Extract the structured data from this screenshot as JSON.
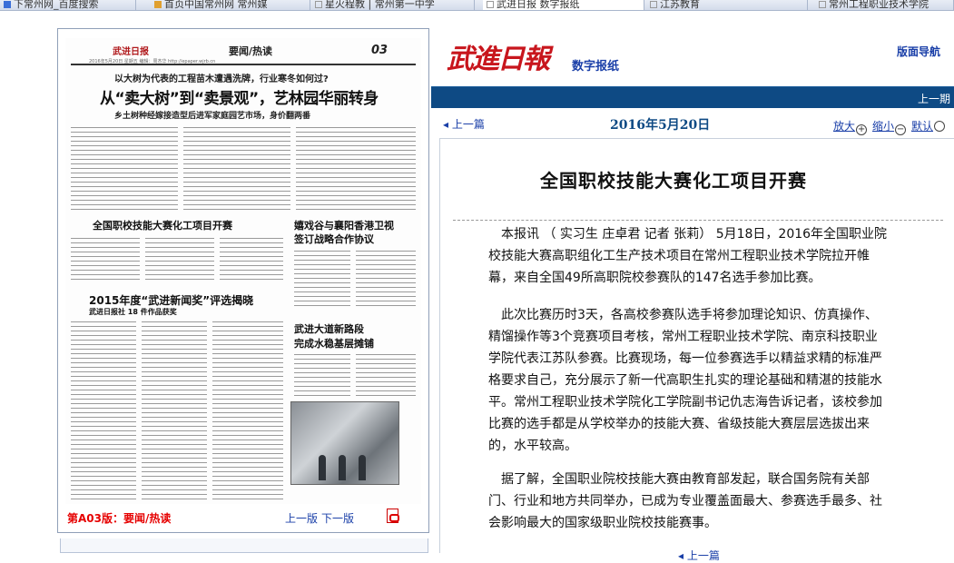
{
  "browser": {
    "tabs": [
      {
        "label": "下常州网_百度搜索",
        "active": false
      },
      {
        "label": "首页中国常州网 常州媒",
        "active": false
      },
      {
        "label": "星火程教 | 常州第一中学",
        "active": false
      },
      {
        "label": "武进日报 数字报纸",
        "active": true
      },
      {
        "label": "江苏教育",
        "active": false
      },
      {
        "label": "常州工程职业技术学院",
        "active": false
      }
    ]
  },
  "thumbnail": {
    "logo": "武进日报",
    "section": "要闻/热读",
    "page_no": "03",
    "meta": "2016年5月20日 星期五    编辑：周杰华    http://epaper.wjrb.cn",
    "kicker": "以大树为代表的工程苗木遭遇洗牌，行业寒冬如何过?",
    "headline": "从“卖大树”到“卖景观”，艺林园华丽转身",
    "subhead": "乡土树种经嫁接造型后进军家庭园艺市场，身价翻两番",
    "story2_title": "全国职校技能大赛化工项目开赛",
    "story3_title_1": "嬉戏谷与襄阳香港卫视",
    "story3_title_2": "签订战略合作协议",
    "story4_title": "2015年度“武进新闻奖”评选揭晓",
    "story4_sub": "武进日报社 18 件作品获奖",
    "story5_title_1": "武进大道新路段",
    "story5_title_2": "完成水稳基层摊铺"
  },
  "thumb_footer": {
    "section_label": "第A03版：要闻/热读",
    "prev": "上一版",
    "next": "下一版",
    "pdf_icon": "pdf-icon"
  },
  "masthead": {
    "logo": "武進日報",
    "subtitle": "数字报纸",
    "nav": "版面导航"
  },
  "bluebar": {
    "prev_issue": "上一期"
  },
  "datebar": {
    "prev_article": "上一篇",
    "date": "2016年5月20日",
    "zoom_in": "放大",
    "zoom_out": "缩小",
    "default": "默认"
  },
  "article": {
    "title": "全国职校技能大赛化工项目开赛",
    "paragraphs": [
      "本报讯 （ 实习生 庄卓君 记者 张莉） 5月18日，2016年全国职业院校技能大赛高职组化工生产技术项目在常州工程职业技术学院拉开帷幕，来自全国49所高职院校参赛队的147名选手参加比赛。",
      "此次比赛历时3天，各高校参赛队选手将参加理论知识、仿真操作、精馏操作等3个竞赛项目考核，常州工程职业技术学院、南京科技职业学院代表江苏队参赛。比赛现场，每一位参赛选手以精益求精的标准严格要求自己，充分展示了新一代高职生扎实的理论基础和精湛的技能水平。常州工程职业技术学院化工学院副书记仇志海告诉记者，该校参加比赛的选手都是从学校举办的技能大赛、省级技能大赛层层选拔出来的，水平较高。",
      "据了解，全国职业院校技能大赛由教育部发起，联合国务院有关部门、行业和地方共同举办，已成为专业覆盖面最大、参赛选手最多、社会影响最大的国家级职业院校技能赛事。"
    ],
    "bottom_prev": "上一篇"
  },
  "colors": {
    "brand_red": "#c8161d",
    "bar_blue": "#0e4a84",
    "link_blue": "#1a3fa8"
  }
}
